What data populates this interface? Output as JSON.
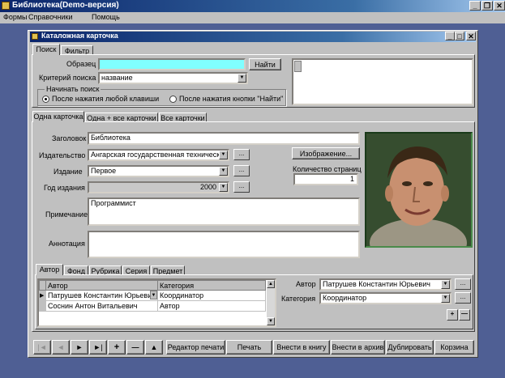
{
  "app": {
    "title": "Библиотека(Demo-версия)",
    "menu": [
      "Формы",
      "Справочники",
      "Помощь"
    ]
  },
  "window": {
    "title": "Каталожная карточка"
  },
  "search": {
    "tabs": [
      "Поиск",
      "Фильтр"
    ],
    "sample_label": "Образец",
    "sample_value": "",
    "find_button": "Найти",
    "criteria_label": "Критерий поиска",
    "criteria_value": "название",
    "start_group_label": "Начинать поиск",
    "radio_any_key": "После нажатия любой клавиши",
    "radio_find_button": "После нажатия кнопки \"Найти\"",
    "radio_selected": "any_key"
  },
  "card_tabs": [
    "Одна карточка",
    "Одна + все карточки",
    "Все карточки"
  ],
  "card": {
    "title_label": "Заголовок",
    "title_value": "Библиотека",
    "publisher_label": "Издательство",
    "publisher_value": "Ангарская государственная техническа",
    "edition_label": "Издание",
    "edition_value": "Первое",
    "year_label": "Год издания",
    "year_value": "2000",
    "pages_label": "Количество страниц",
    "pages_value": "1",
    "image_button": "Изображение...",
    "note_label": "Примечание",
    "note_value": "Программист",
    "annotation_label": "Аннотация",
    "annotation_value": "",
    "dots": "..."
  },
  "author_tabs": [
    "Автор",
    "Фонд",
    "Рубрика",
    "Серия",
    "Предмет"
  ],
  "authors_table": {
    "columns": [
      "Автор",
      "Категория"
    ],
    "rows": [
      {
        "author": "Патрушев Константин Юрьевич",
        "category": "Координатор"
      },
      {
        "author": "Соснин Антон Витальевич",
        "category": "Автор"
      }
    ]
  },
  "author_detail": {
    "author_label": "Автор",
    "author_value": "Патрушев Константин Юрьевич",
    "category_label": "Категория",
    "category_value": "Координатор"
  },
  "toolbar": {
    "nav": [
      "|◄",
      "◄",
      "►",
      "►|",
      "+",
      "—",
      "▲"
    ],
    "buttons": [
      "Редактор печати",
      "Печать",
      "Внести в книгу",
      "Внести в архив",
      "Дублировать",
      "Корзина"
    ]
  }
}
